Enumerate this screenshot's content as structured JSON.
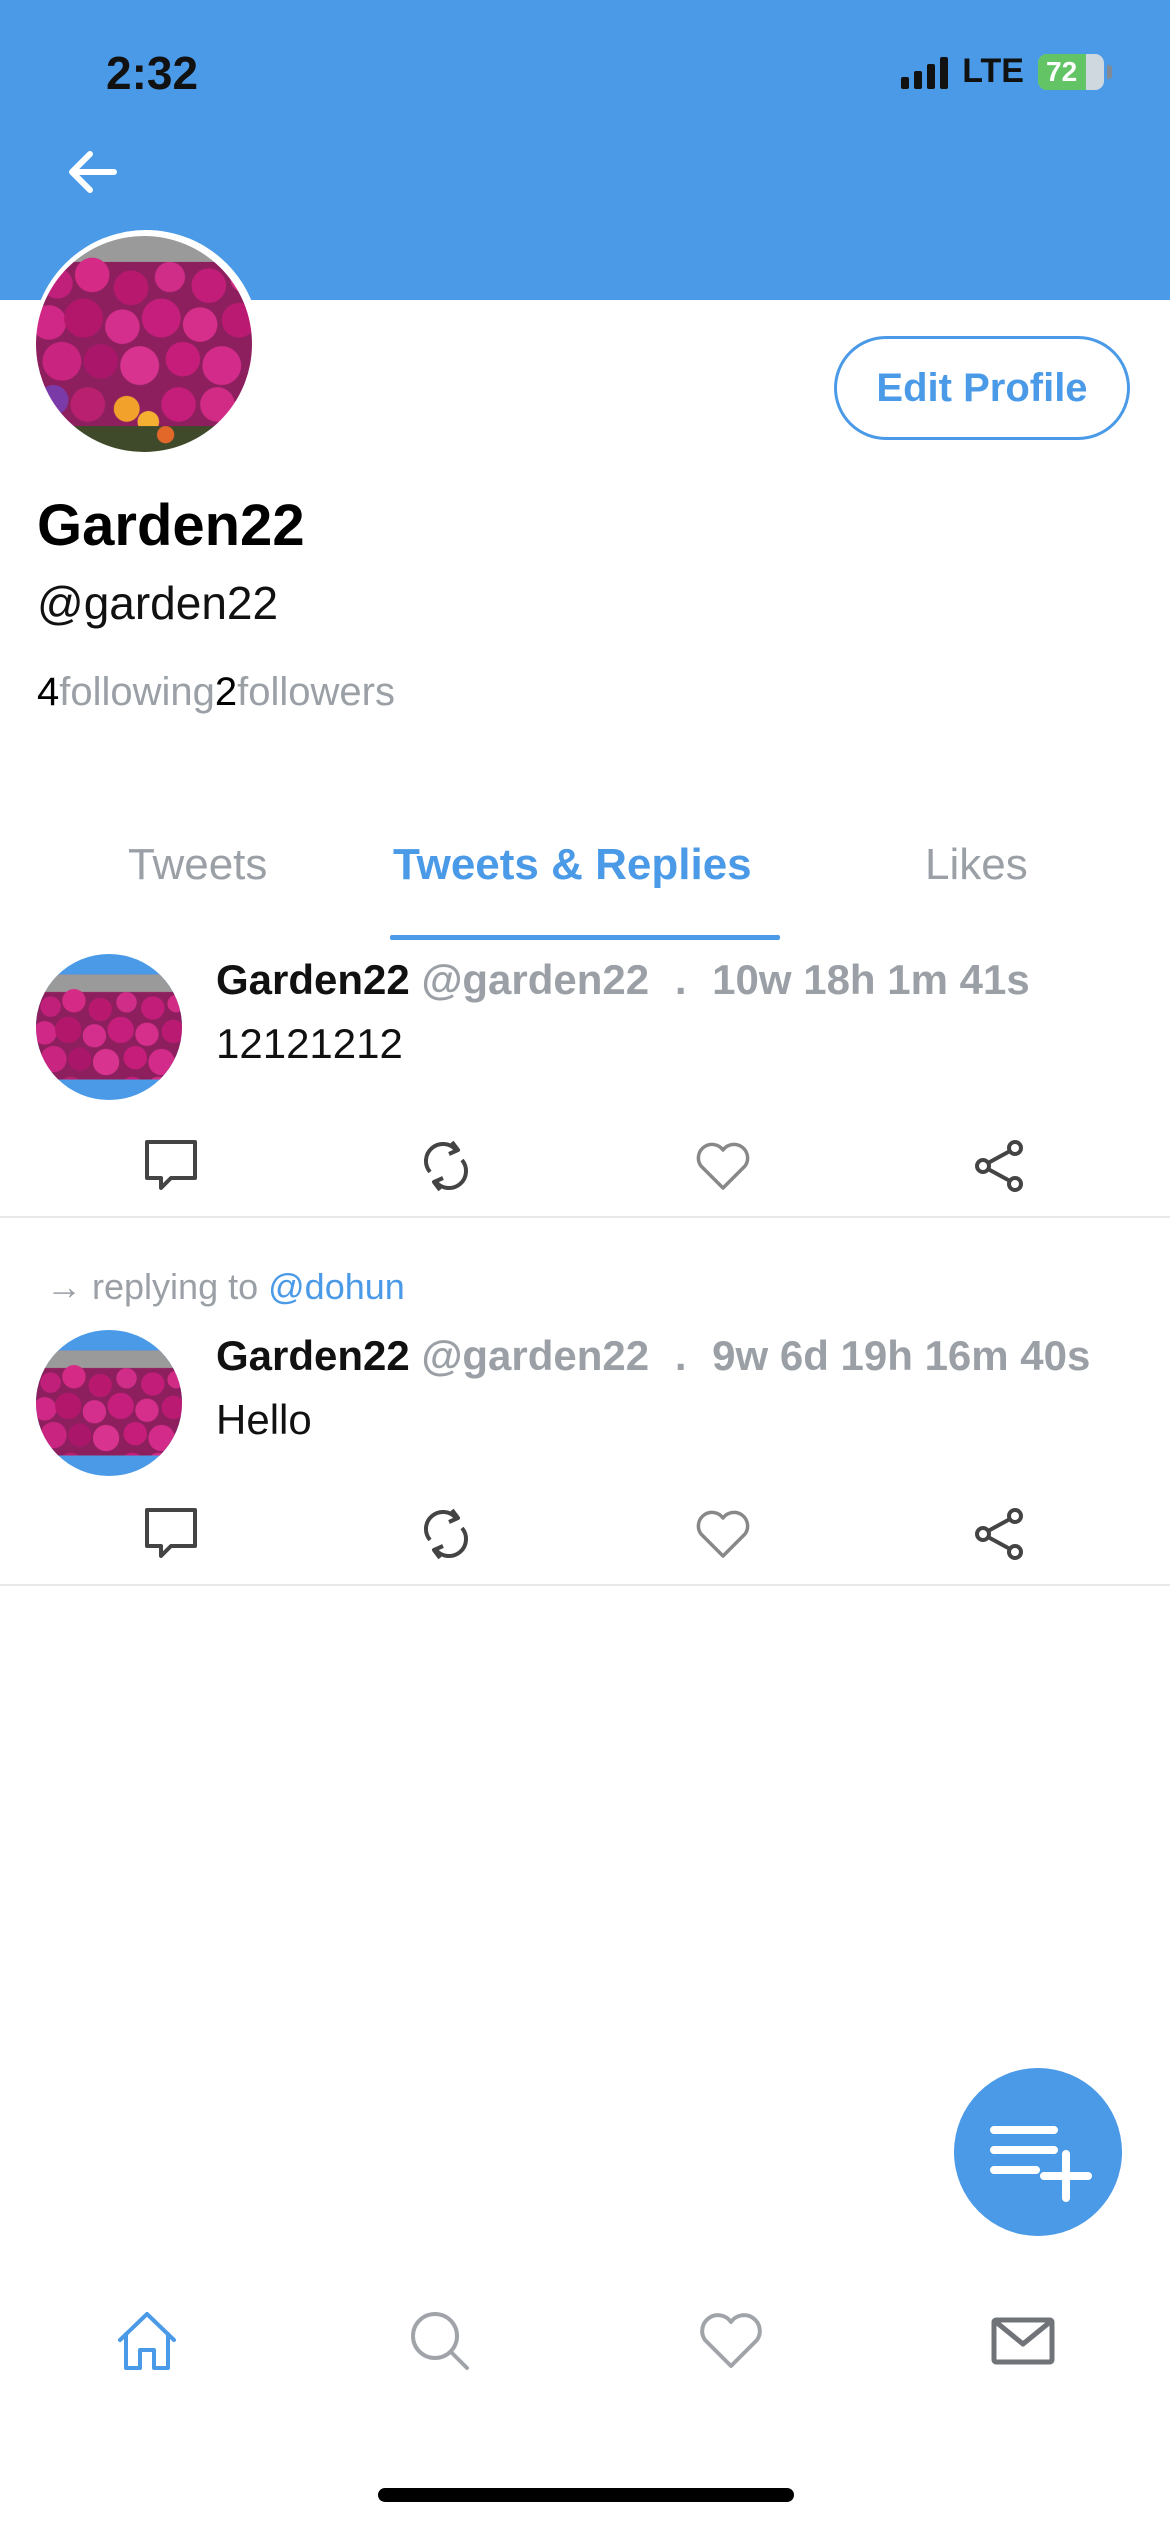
{
  "status_bar": {
    "time": "2:32",
    "network": "LTE",
    "battery": "72"
  },
  "profile": {
    "display_name": "Garden22",
    "handle": "@garden22",
    "edit_label": "Edit Profile",
    "following_count": "4",
    "following_label": "following",
    "followers_count": "2",
    "followers_label": "followers"
  },
  "tabs": [
    {
      "label": "Tweets",
      "active": false
    },
    {
      "label": "Tweets & Replies",
      "active": true
    },
    {
      "label": "Likes",
      "active": false
    }
  ],
  "tweets": [
    {
      "name": "Garden22",
      "handle": "@garden22",
      "sep": ".",
      "time": "10w 18h 1m 41s",
      "text": "12121212",
      "reply_prefix": "",
      "reply_to": ""
    },
    {
      "name": "Garden22",
      "handle": "@garden22",
      "sep": ".",
      "time": "9w 6d 19h 16m 40s",
      "text": "Hello",
      "reply_prefix": "replying to",
      "reply_to": "@dohun"
    }
  ],
  "colors": {
    "accent": "#4a9ae8",
    "muted": "#9aa0a6",
    "battery_green": "#63c466"
  },
  "icons": {
    "back": "arrow-left-icon",
    "reply": "comment-icon",
    "retweet": "retweet-icon",
    "like": "heart-icon",
    "share": "share-icon",
    "compose": "compose-icon",
    "nav_home": "home-icon",
    "nav_search": "search-icon",
    "nav_likes": "heart-icon",
    "nav_messages": "mail-icon"
  }
}
